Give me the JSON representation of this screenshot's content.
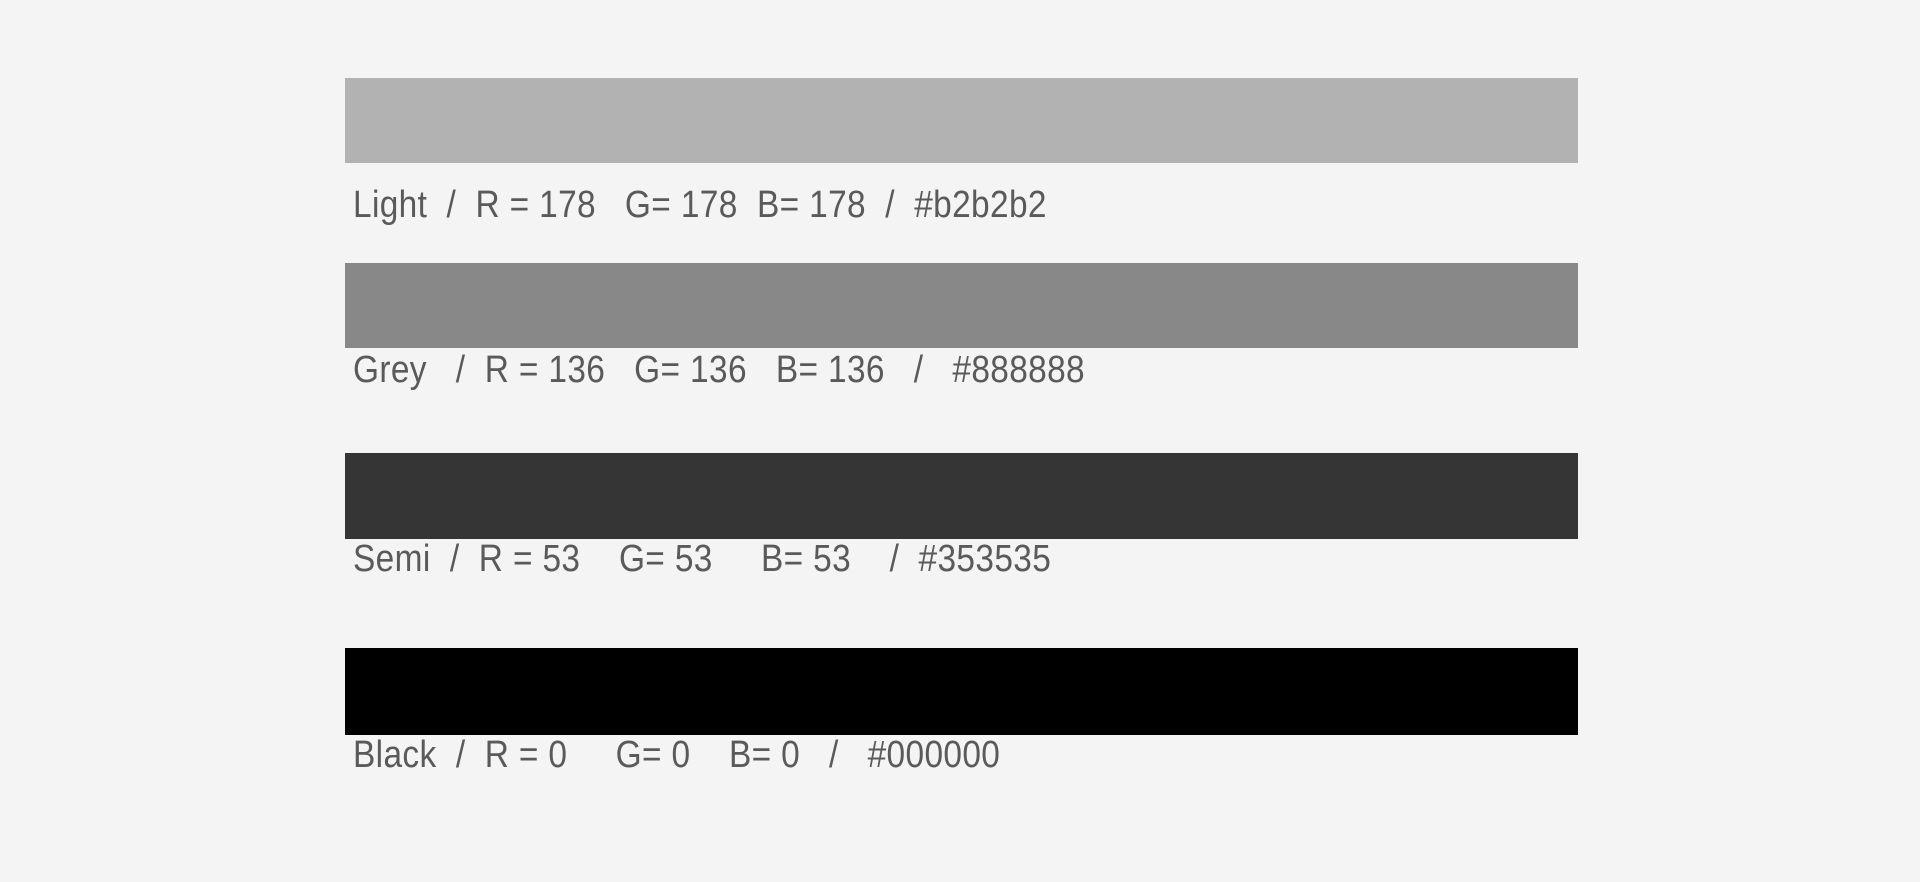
{
  "page": {
    "background_color": "#f4f4f4",
    "caption_text_color": "#5a5a5a"
  },
  "palette": {
    "swatches": [
      {
        "name": "Light",
        "r": "178",
        "g": "178",
        "b": "178",
        "hex": "#b2b2b2",
        "caption": "Light  /  R = 178   G= 178  B= 178  /  #b2b2b2"
      },
      {
        "name": "Grey",
        "r": "136",
        "g": "136",
        "b": "136",
        "hex": "#888888",
        "caption": "Grey   /  R = 136   G= 136   B= 136   /   #888888"
      },
      {
        "name": "Semi",
        "r": "53",
        "g": "53",
        "b": "53",
        "hex": "#353535",
        "caption": "Semi  /  R = 53    G= 53     B= 53    /  #353535"
      },
      {
        "name": "Black",
        "r": "0",
        "g": "0",
        "b": "0",
        "hex": "#000000",
        "caption": "Black  /  R = 0     G= 0    B= 0   /   #000000"
      }
    ]
  }
}
